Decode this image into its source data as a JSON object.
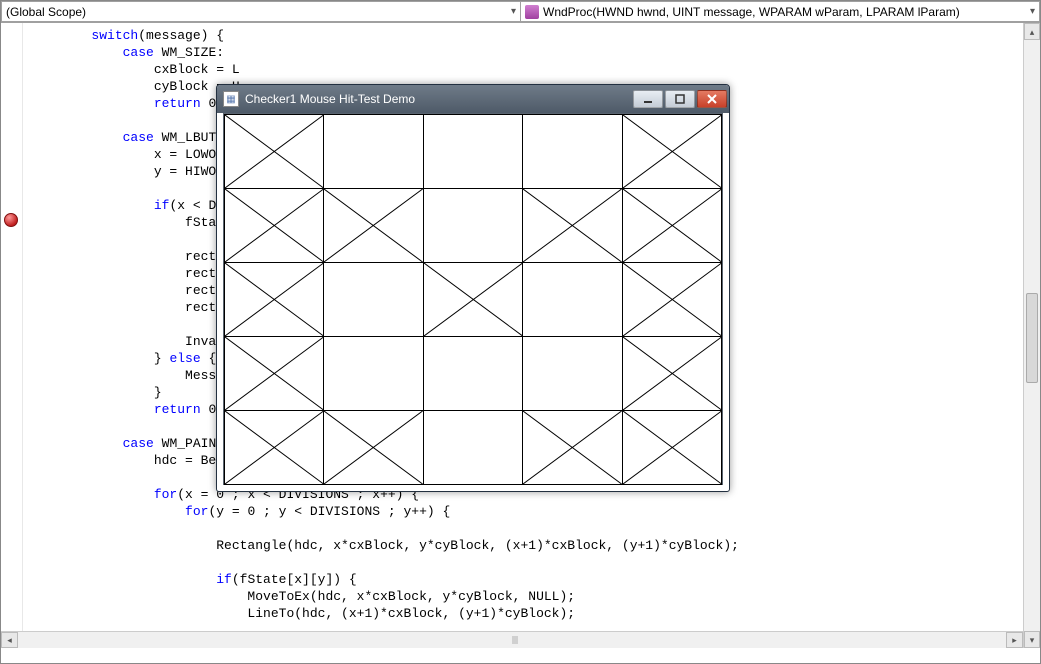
{
  "toolbar": {
    "scope_label": "(Global Scope)",
    "function_label": "WndProc(HWND hwnd, UINT message, WPARAM wParam, LPARAM lParam)"
  },
  "window": {
    "title": "Checker1 Mouse Hit-Test Demo",
    "grid": {
      "cols": 5,
      "rows": 5,
      "marked": [
        [
          0,
          0
        ],
        [
          4,
          0
        ],
        [
          0,
          1
        ],
        [
          1,
          1
        ],
        [
          3,
          1
        ],
        [
          4,
          1
        ],
        [
          0,
          2
        ],
        [
          2,
          2
        ],
        [
          4,
          2
        ],
        [
          0,
          3
        ],
        [
          4,
          3
        ],
        [
          0,
          4
        ],
        [
          1,
          4
        ],
        [
          3,
          4
        ],
        [
          4,
          4
        ]
      ]
    }
  },
  "code": {
    "lines": [
      {
        "indent": 2,
        "tokens": [
          {
            "t": "switch",
            "c": "kw"
          },
          {
            "t": "(message) {"
          }
        ]
      },
      {
        "indent": 3,
        "tokens": [
          {
            "t": "case",
            "c": "kw"
          },
          {
            "t": " WM_SIZE:"
          }
        ]
      },
      {
        "indent": 4,
        "tokens": [
          {
            "t": "cxBlock = L"
          }
        ]
      },
      {
        "indent": 4,
        "tokens": [
          {
            "t": "cyBlock = H"
          }
        ]
      },
      {
        "indent": 4,
        "tokens": [
          {
            "t": "return",
            "c": "kw"
          },
          {
            "t": " 0;"
          }
        ]
      },
      {
        "indent": 0,
        "tokens": [
          {
            "t": ""
          }
        ]
      },
      {
        "indent": 3,
        "tokens": [
          {
            "t": "case",
            "c": "kw"
          },
          {
            "t": " WM_LBUTTON"
          }
        ]
      },
      {
        "indent": 4,
        "tokens": [
          {
            "t": "x = LOWORD("
          }
        ]
      },
      {
        "indent": 4,
        "tokens": [
          {
            "t": "y = HIWORD("
          }
        ]
      },
      {
        "indent": 0,
        "tokens": [
          {
            "t": ""
          }
        ]
      },
      {
        "indent": 4,
        "tokens": [
          {
            "t": "if",
            "c": "kw"
          },
          {
            "t": "(x < DIVI"
          }
        ]
      },
      {
        "indent": 5,
        "tokens": [
          {
            "t": "fState["
          }
        ]
      },
      {
        "indent": 0,
        "tokens": [
          {
            "t": ""
          }
        ]
      },
      {
        "indent": 5,
        "tokens": [
          {
            "t": "rect.le"
          }
        ]
      },
      {
        "indent": 5,
        "tokens": [
          {
            "t": "rect.to"
          }
        ]
      },
      {
        "indent": 5,
        "tokens": [
          {
            "t": "rect.ri"
          }
        ]
      },
      {
        "indent": 5,
        "tokens": [
          {
            "t": "rect.bo"
          }
        ]
      },
      {
        "indent": 0,
        "tokens": [
          {
            "t": ""
          }
        ]
      },
      {
        "indent": 5,
        "tokens": [
          {
            "t": "Invalid"
          }
        ]
      },
      {
        "indent": 4,
        "tokens": [
          {
            "t": "} "
          },
          {
            "t": "else",
            "c": "kw"
          },
          {
            "t": " {"
          }
        ]
      },
      {
        "indent": 5,
        "tokens": [
          {
            "t": "Message"
          }
        ]
      },
      {
        "indent": 4,
        "tokens": [
          {
            "t": "}"
          }
        ]
      },
      {
        "indent": 4,
        "tokens": [
          {
            "t": "return",
            "c": "kw"
          },
          {
            "t": " 0;"
          }
        ]
      },
      {
        "indent": 0,
        "tokens": [
          {
            "t": ""
          }
        ]
      },
      {
        "indent": 3,
        "tokens": [
          {
            "t": "case",
            "c": "kw"
          },
          {
            "t": " WM_PAINT:"
          }
        ]
      },
      {
        "indent": 4,
        "tokens": [
          {
            "t": "hdc = Begin"
          }
        ]
      },
      {
        "indent": 0,
        "tokens": [
          {
            "t": ""
          }
        ]
      },
      {
        "indent": 4,
        "tokens": [
          {
            "t": "for",
            "c": "kw"
          },
          {
            "t": "(x = 0 ; x < DIVISIONS ; x++) {"
          }
        ]
      },
      {
        "indent": 5,
        "tokens": [
          {
            "t": "for",
            "c": "kw"
          },
          {
            "t": "(y = 0 ; y < DIVISIONS ; y++) {"
          }
        ]
      },
      {
        "indent": 0,
        "tokens": [
          {
            "t": ""
          }
        ]
      },
      {
        "indent": 6,
        "tokens": [
          {
            "t": "Rectangle(hdc, x*cxBlock, y*cyBlock, (x+1)*cxBlock, (y+1)*cyBlock);"
          }
        ]
      },
      {
        "indent": 0,
        "tokens": [
          {
            "t": ""
          }
        ]
      },
      {
        "indent": 6,
        "tokens": [
          {
            "t": "if",
            "c": "kw"
          },
          {
            "t": "(fState[x][y]) {"
          }
        ]
      },
      {
        "indent": 7,
        "tokens": [
          {
            "t": "MoveToEx(hdc, x*cxBlock, y*cyBlock, NULL);"
          }
        ]
      },
      {
        "indent": 7,
        "tokens": [
          {
            "t": "LineTo(hdc, (x+1)*cxBlock, (y+1)*cyBlock);"
          }
        ]
      }
    ]
  }
}
